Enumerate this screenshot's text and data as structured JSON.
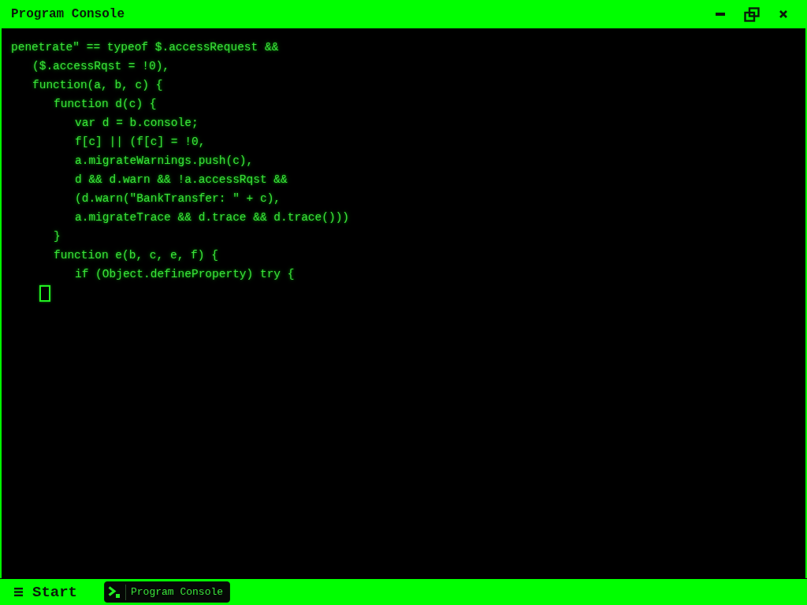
{
  "window": {
    "title": "Program Console"
  },
  "console": {
    "lines": [
      {
        "text": "penetrate\" == typeof $.accessRequest &&",
        "children": [
          {
            "text": "($.accessRqst = !0),"
          },
          {
            "text": "function(a, b, c) {",
            "children": [
              {
                "text": "function d(c) {",
                "children": [
                  {
                    "text": "var d = b.console;"
                  },
                  {
                    "text": "f[c] || (f[c] = !0,"
                  },
                  {
                    "text": "a.migrateWarnings.push(c),"
                  },
                  {
                    "text": "d && d.warn && !a.accessRqst &&"
                  },
                  {
                    "text": "(d.warn(\"BankTransfer: \" + c),"
                  },
                  {
                    "text": "a.migrateTrace && d.trace && d.trace()))"
                  }
                ]
              },
              {
                "text": "}"
              },
              {
                "text": "function e(b, c, e, f) {",
                "children": [
                  {
                    "text": "if (Object.defineProperty) try {"
                  }
                ]
              }
            ]
          }
        ]
      }
    ]
  },
  "taskbar": {
    "start": {
      "label": "Start"
    },
    "items": [
      {
        "label": "Program Console",
        "selected": true
      }
    ]
  }
}
